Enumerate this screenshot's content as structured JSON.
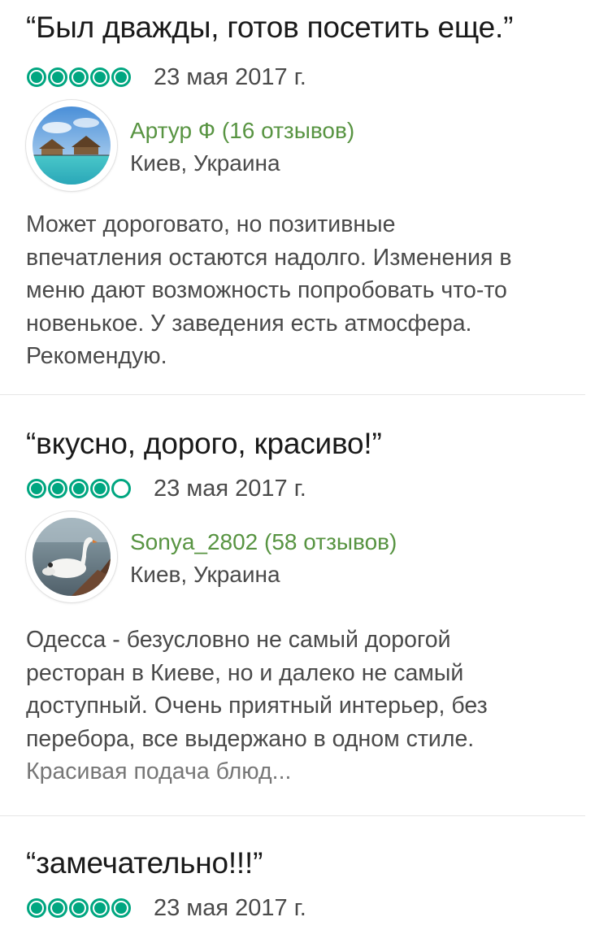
{
  "reviews": [
    {
      "title": "“Был дважды, готов посетить еще.”",
      "rating": 5,
      "date": "23 мая 2017 г.",
      "author_name": "Артур Ф (16 отзывов)",
      "author_location": "Киев, Украина",
      "avatar_icon": "tropical-bungalow-photo",
      "body_lines": [
        "Может дороговато, но позитивные",
        "впечатления остаются надолго. Изменения в",
        "меню дают возможность попробовать что-то",
        "новенькое. У заведения есть атмосфера.",
        "Рекомендую."
      ]
    },
    {
      "title": "“вкусно, дорого, красиво!”",
      "rating": 4,
      "date": "23 мая 2017 г.",
      "author_name": "Sonya_2802 (58 отзывов)",
      "author_location": "Киев, Украина",
      "avatar_icon": "swan-photo",
      "body_lines": [
        "Одесса - безусловно не самый дорогой",
        "ресторан в Киеве, но и далеко не самый",
        "доступный. Очень приятный интерьер, без",
        "перебора, все выдержано в одном стиле."
      ],
      "body_more": "Красивая подача блюд..."
    },
    {
      "title": "“замечательно!!!”",
      "rating": 5,
      "date": "23 мая 2017 г."
    }
  ],
  "colors": {
    "rating_green": "#00a680",
    "author_green": "#589442",
    "body_gray": "#4a4a4a",
    "divider": "#e6e6e6"
  }
}
